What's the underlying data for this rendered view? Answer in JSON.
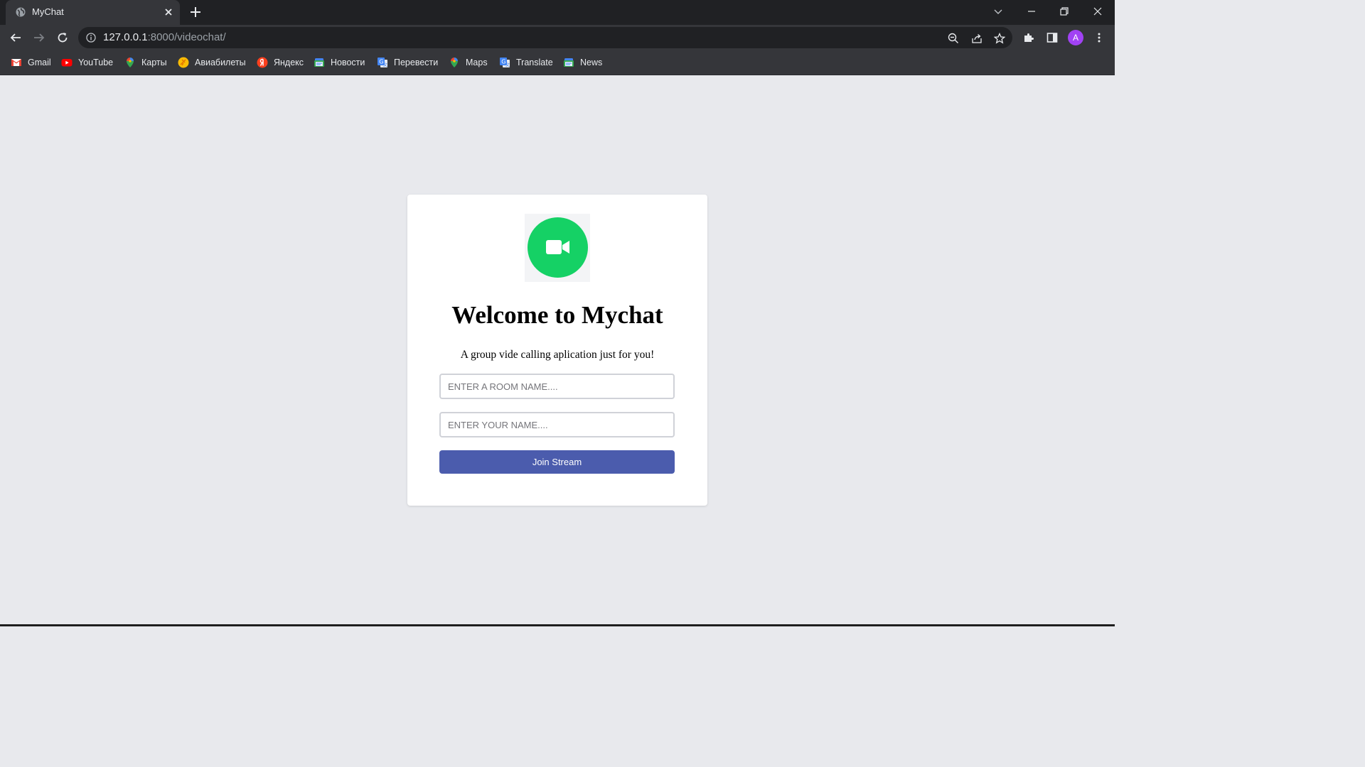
{
  "browser": {
    "tab_title": "MyChat",
    "url_host": "127.0.0.1",
    "url_rest": ":8000/videochat/",
    "profile_initial": "A",
    "bookmarks": [
      {
        "label": "Gmail",
        "icon": "gmail-icon"
      },
      {
        "label": "YouTube",
        "icon": "youtube-icon"
      },
      {
        "label": "Карты",
        "icon": "maps-pin-icon"
      },
      {
        "label": "Авиабилеты",
        "icon": "flights-icon"
      },
      {
        "label": "Яндекс",
        "icon": "yandex-icon"
      },
      {
        "label": "Новости",
        "icon": "news-icon"
      },
      {
        "label": "Перевести",
        "icon": "translate-icon"
      },
      {
        "label": "Maps",
        "icon": "maps-pin-icon"
      },
      {
        "label": "Translate",
        "icon": "translate-icon"
      },
      {
        "label": "News",
        "icon": "news-icon"
      }
    ]
  },
  "page": {
    "heading": "Welcome to Mychat",
    "subtitle": "A group vide calling aplication just for you!",
    "room_placeholder": "ENTER A ROOM NAME....",
    "name_placeholder": "ENTER YOUR NAME....",
    "join_label": "Join Stream",
    "logo_icon": "video-camera-icon",
    "accent_color": "#15d165",
    "button_color": "#4b5cad"
  }
}
